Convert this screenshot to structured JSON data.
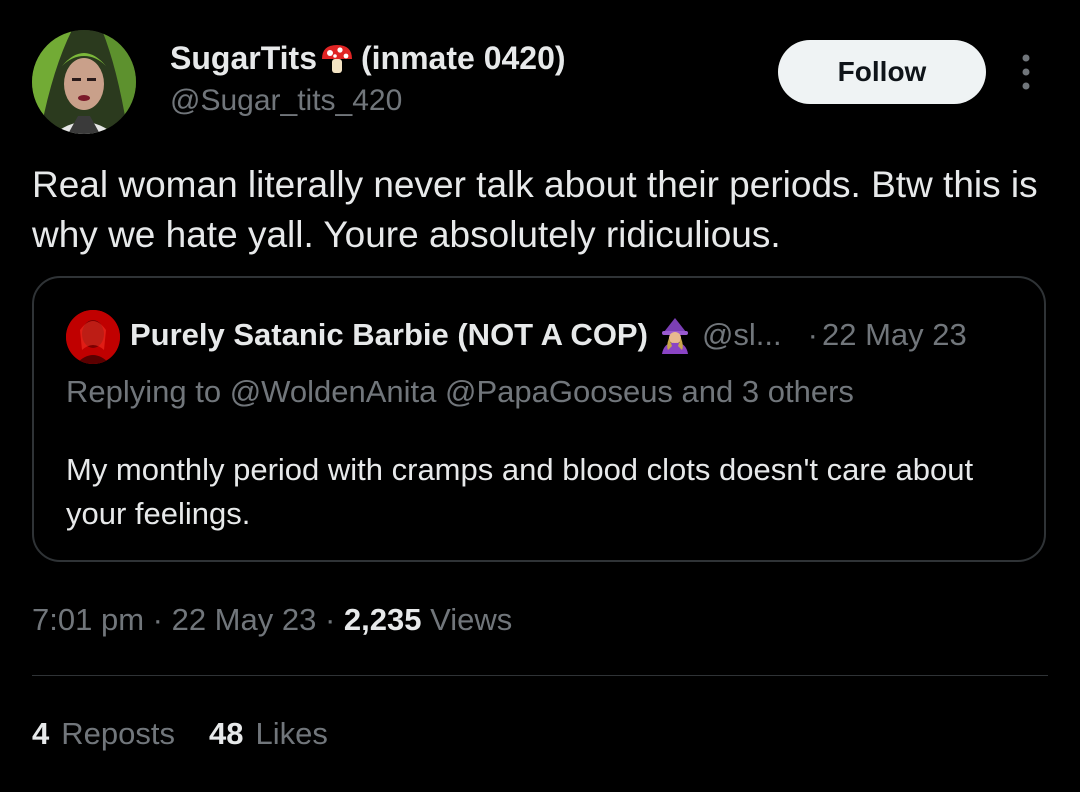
{
  "author": {
    "display_name": "SugarTits",
    "name_suffix": "(inmate 0420)",
    "name_emoji": "mushroom-icon",
    "handle": "@Sugar_tits_420"
  },
  "follow_button": {
    "label": "Follow"
  },
  "more_menu": {
    "icon": "more-vertical-icon"
  },
  "tweet": {
    "text": "Real woman literally never talk about their periods. Btw this is why we hate yall. Youre absolutely ridiculious."
  },
  "quoted_tweet": {
    "display_name": "Purely Satanic Barbie (NOT A COP)",
    "name_emoji": "woman-mage-icon",
    "handle": "@sl...",
    "dot": "·",
    "date": "22 May 23",
    "replying_to": "Replying to @WoldenAnita @PapaGooseus and 3 others",
    "text": "My monthly period with cramps and blood clots doesn't care about your feelings."
  },
  "meta": {
    "time": "7:01 pm",
    "sep1": " · ",
    "date": "22 May 23",
    "sep2": " · ",
    "views_count": "2,235",
    "views_label": "Views"
  },
  "stats": {
    "reposts_count": "4",
    "reposts_label": "Reposts",
    "likes_count": "48",
    "likes_label": "Likes"
  },
  "colors": {
    "background": "#000000",
    "primary_text": "#e7e9ea",
    "secondary_text": "#71767b",
    "border": "#2f3336",
    "follow_bg": "#eff3f4",
    "follow_text": "#0f1419"
  }
}
